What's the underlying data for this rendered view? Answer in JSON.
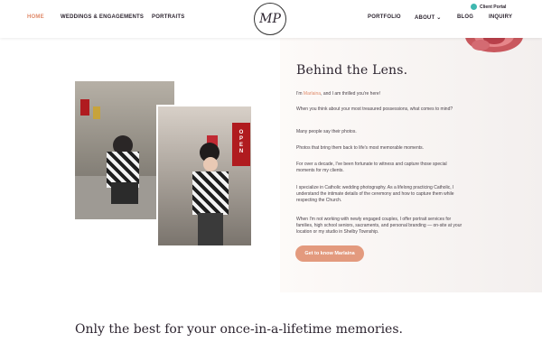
{
  "nav": {
    "home": "HOME",
    "weddings": "WEDDINGS & ENGAGEMENTS",
    "portraits": "PORTRAITS",
    "portfolio": "PORTFOLIO",
    "about": "ABOUT",
    "blog": "BLOG",
    "inquiry": "INQUIRY"
  },
  "logo": {
    "initials": "MP"
  },
  "client_portal": {
    "label": "Client Portal"
  },
  "about": {
    "title": "Behind the Lens.",
    "intro_prefix": "I'm ",
    "name": "Marlaina",
    "intro_suffix": ", and I am thrilled you're here!",
    "paragraphs": [
      "When you think about your most treasured possessions, what comes to mind?",
      "Many people say their photos.",
      "Photos that bring them back to life's most memorable moments.",
      "For over a decade, I've been fortunate to witness and capture those special moments for my clients.",
      "I specialize in Catholic wedding photography. As a lifelong practicing Catholic, I understand the intimate details of the ceremony and how to capture them while respecting the Church.",
      "When I'm not working with newly engaged couples, I offer portrait services for families, high school seniors, sacraments, and personal branding — on-site at your location or my studio in Shelby Township."
    ],
    "cta": "Get to know Marlaina"
  },
  "section_heading": "Only the best for your once-in-a-lifetime memories.",
  "colors": {
    "accent": "#e08b6b",
    "button": "#e39a7e",
    "portal_icon": "#3fb8b0"
  }
}
